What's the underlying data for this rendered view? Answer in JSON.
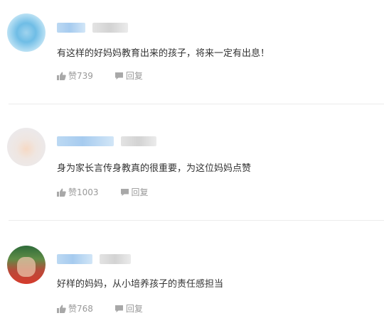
{
  "comments": [
    {
      "text": "有这样的好妈妈教育出来的孩子，将来一定有出息！",
      "likes": "赞739",
      "reply": "回复"
    },
    {
      "text": "身为家长言传身教真的很重要，为这位妈妈点赞",
      "likes": "赞1003",
      "reply": "回复"
    },
    {
      "text": "好样的妈妈，从小培养孩子的责任感担当",
      "likes": "赞768",
      "reply": "回复"
    }
  ],
  "colors": {
    "text": "#333333",
    "meta": "#999999",
    "divider": "#ececec"
  },
  "icons": [
    "thumbs-up-icon",
    "speech-bubble-icon"
  ]
}
